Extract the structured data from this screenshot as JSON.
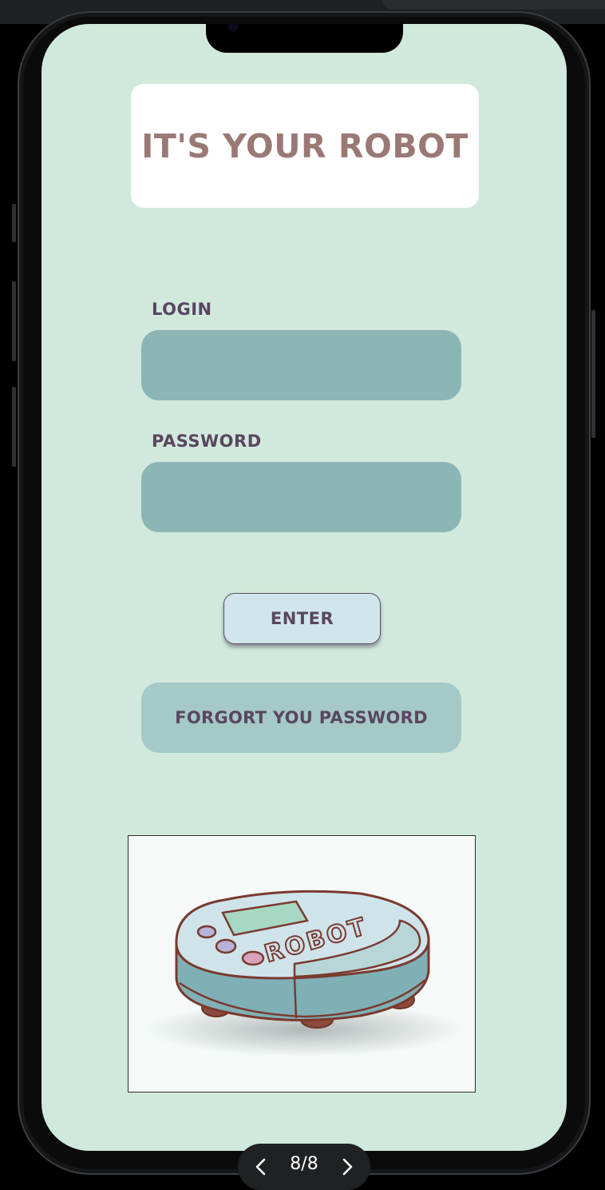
{
  "app": {
    "title": "IT'S YOUR ROBOT"
  },
  "form": {
    "login_label": "LOGIN",
    "login_value": "",
    "password_label": "PASSWORD",
    "password_value": "",
    "enter_label": "ENTER",
    "forgot_label": "FORGORT YOU PASSWORD"
  },
  "illustration": {
    "name": "robot-vacuum-illustration",
    "caption_text": "ROBOT"
  },
  "pager": {
    "count": "8/8",
    "prev_icon": "chevron-left-icon",
    "next_icon": "chevron-right-icon"
  },
  "colors": {
    "screen_bg": "#d1e9dc",
    "title_text": "#9a7975",
    "input_bg": "#8cb5b5",
    "button_bg": "#d0e6ec",
    "forgot_bg": "#a4c9c6",
    "label_text": "#5a4660"
  }
}
